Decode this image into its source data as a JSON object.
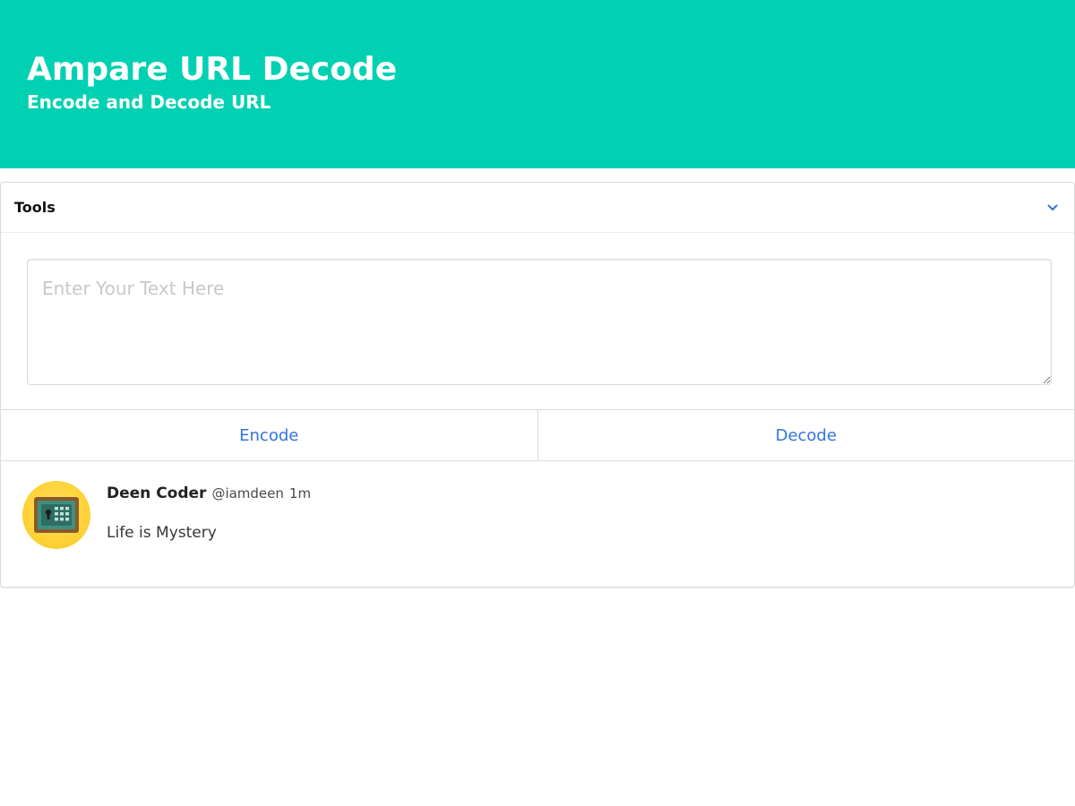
{
  "hero": {
    "title": "Ampare URL Decode",
    "subtitle": "Encode and Decode URL"
  },
  "panel": {
    "title": "Tools",
    "toggle_icon": "chevron-down-icon"
  },
  "input": {
    "placeholder": "Enter Your Text Here",
    "value": ""
  },
  "actions": {
    "encode_label": "Encode",
    "decode_label": "Decode"
  },
  "post": {
    "avatar_icon": "safe-icon",
    "name": "Deen Coder",
    "handle": "@iamdeen",
    "time": "1m",
    "text": "Life is Mystery"
  },
  "colors": {
    "primary": "#00d1b2",
    "link": "#3273dc"
  }
}
